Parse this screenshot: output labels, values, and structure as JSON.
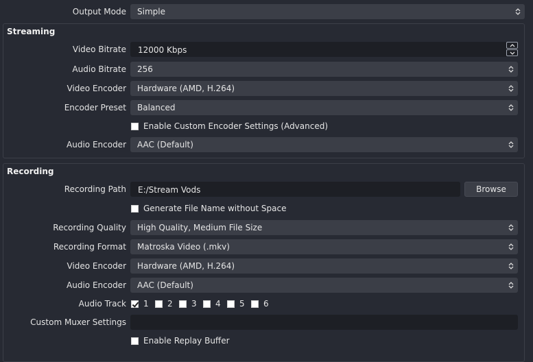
{
  "output_mode": {
    "label": "Output Mode",
    "value": "Simple"
  },
  "streaming": {
    "title": "Streaming",
    "video_bitrate": {
      "label": "Video Bitrate",
      "value": "12000 Kbps"
    },
    "audio_bitrate": {
      "label": "Audio Bitrate",
      "value": "256"
    },
    "video_encoder": {
      "label": "Video Encoder",
      "value": "Hardware (AMD, H.264)"
    },
    "encoder_preset": {
      "label": "Encoder Preset",
      "value": "Balanced"
    },
    "custom_encoder": {
      "label": "Enable Custom Encoder Settings (Advanced)",
      "checked": false
    },
    "audio_encoder": {
      "label": "Audio Encoder",
      "value": "AAC (Default)"
    }
  },
  "recording": {
    "title": "Recording",
    "path": {
      "label": "Recording Path",
      "value": "E:/Stream Vods",
      "browse_label": "Browse"
    },
    "no_space": {
      "label": "Generate File Name without Space",
      "checked": false
    },
    "quality": {
      "label": "Recording Quality",
      "value": "High Quality, Medium File Size"
    },
    "format": {
      "label": "Recording Format",
      "value": "Matroska Video (.mkv)"
    },
    "video_encoder": {
      "label": "Video Encoder",
      "value": "Hardware (AMD, H.264)"
    },
    "audio_encoder": {
      "label": "Audio Encoder",
      "value": "AAC (Default)"
    },
    "audio_track": {
      "label": "Audio Track",
      "tracks": [
        {
          "label": "1",
          "checked": true
        },
        {
          "label": "2",
          "checked": false
        },
        {
          "label": "3",
          "checked": false
        },
        {
          "label": "4",
          "checked": false
        },
        {
          "label": "5",
          "checked": false
        },
        {
          "label": "6",
          "checked": false
        }
      ]
    },
    "muxer": {
      "label": "Custom Muxer Settings",
      "value": ""
    },
    "replay_buffer": {
      "label": "Enable Replay Buffer",
      "checked": false
    }
  }
}
